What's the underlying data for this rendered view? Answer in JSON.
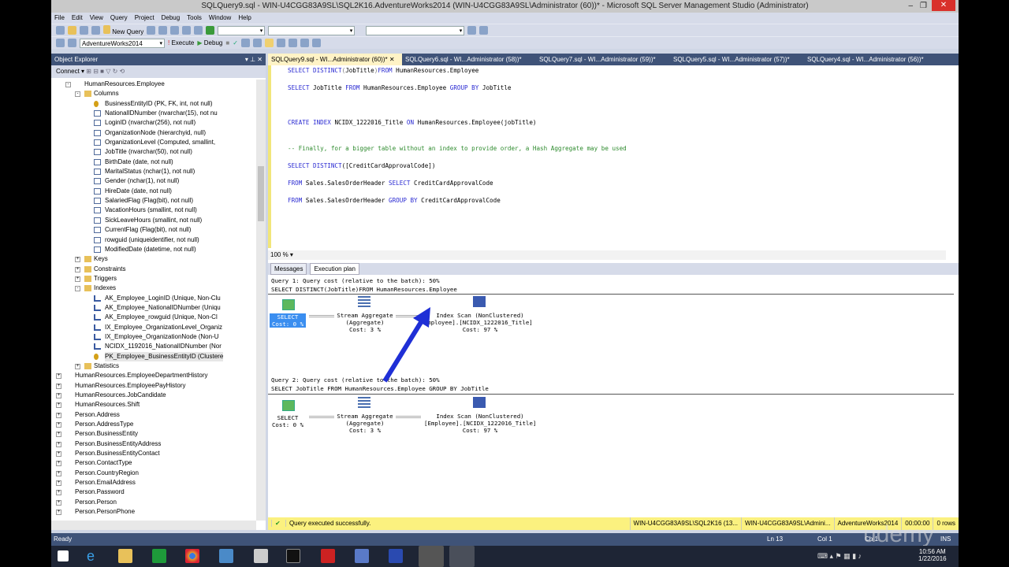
{
  "window": {
    "title": "SQLQuery9.sql - WIN-U4CGG83A9SL\\SQL2K16.AdventureWorks2014 (WIN-U4CGG83A9SL\\Administrator (60))* - Microsoft SQL Server Management Studio (Administrator)"
  },
  "menu": [
    "File",
    "Edit",
    "View",
    "Query",
    "Project",
    "Debug",
    "Tools",
    "Window",
    "Help"
  ],
  "toolbar": {
    "new_query": "New Query",
    "database": "AdventureWorks2014",
    "execute": "Execute",
    "debug": "Debug"
  },
  "object_explorer": {
    "title": "Object Explorer",
    "connect": "Connect ▾",
    "items": [
      {
        "label": "HumanResources.Employee",
        "level": 1,
        "type": "table",
        "exp": "-"
      },
      {
        "label": "Columns",
        "level": 2,
        "type": "folder",
        "exp": "-"
      },
      {
        "label": "BusinessEntityID (PK, FK, int, not null)",
        "level": 3,
        "type": "key"
      },
      {
        "label": "NationalIDNumber (nvarchar(15), not nu",
        "level": 3,
        "type": "col"
      },
      {
        "label": "LoginID (nvarchar(256), not null)",
        "level": 3,
        "type": "col"
      },
      {
        "label": "OrganizationNode (hierarchyid, null)",
        "level": 3,
        "type": "col"
      },
      {
        "label": "OrganizationLevel (Computed, smallint,",
        "level": 3,
        "type": "col"
      },
      {
        "label": "JobTitle (nvarchar(50), not null)",
        "level": 3,
        "type": "col"
      },
      {
        "label": "BirthDate (date, not null)",
        "level": 3,
        "type": "col"
      },
      {
        "label": "MaritalStatus (nchar(1), not null)",
        "level": 3,
        "type": "col"
      },
      {
        "label": "Gender (nchar(1), not null)",
        "level": 3,
        "type": "col"
      },
      {
        "label": "HireDate (date, not null)",
        "level": 3,
        "type": "col"
      },
      {
        "label": "SalariedFlag (Flag(bit), not null)",
        "level": 3,
        "type": "col"
      },
      {
        "label": "VacationHours (smallint, not null)",
        "level": 3,
        "type": "col"
      },
      {
        "label": "SickLeaveHours (smallint, not null)",
        "level": 3,
        "type": "col"
      },
      {
        "label": "CurrentFlag (Flag(bit), not null)",
        "level": 3,
        "type": "col"
      },
      {
        "label": "rowguid (uniqueidentifier, not null)",
        "level": 3,
        "type": "col"
      },
      {
        "label": "ModifiedDate (datetime, not null)",
        "level": 3,
        "type": "col"
      },
      {
        "label": "Keys",
        "level": 2,
        "type": "folder",
        "exp": "+"
      },
      {
        "label": "Constraints",
        "level": 2,
        "type": "folder",
        "exp": "+"
      },
      {
        "label": "Triggers",
        "level": 2,
        "type": "folder",
        "exp": "+"
      },
      {
        "label": "Indexes",
        "level": 2,
        "type": "folder",
        "exp": "-"
      },
      {
        "label": "AK_Employee_LoginID (Unique, Non-Clu",
        "level": 3,
        "type": "idx"
      },
      {
        "label": "AK_Employee_NationalIDNumber (Uniqu",
        "level": 3,
        "type": "idx"
      },
      {
        "label": "AK_Employee_rowguid (Unique, Non-Cl",
        "level": 3,
        "type": "idx"
      },
      {
        "label": "IX_Employee_OrganizationLevel_Organiz",
        "level": 3,
        "type": "idx"
      },
      {
        "label": "IX_Employee_OrganizationNode (Non-U",
        "level": 3,
        "type": "idx"
      },
      {
        "label": "NCIDX_1192016_NationalIDNumber (Nor",
        "level": 3,
        "type": "idx"
      },
      {
        "label": "PK_Employee_BusinessEntityID (Clustere",
        "level": 3,
        "type": "key"
      },
      {
        "label": "Statistics",
        "level": 2,
        "type": "folder",
        "exp": "+"
      },
      {
        "label": "HumanResources.EmployeeDepartmentHistory",
        "level": 0,
        "type": "table",
        "exp": "+"
      },
      {
        "label": "HumanResources.EmployeePayHistory",
        "level": 0,
        "type": "table",
        "exp": "+"
      },
      {
        "label": "HumanResources.JobCandidate",
        "level": 0,
        "type": "table",
        "exp": "+"
      },
      {
        "label": "HumanResources.Shift",
        "level": 0,
        "type": "table",
        "exp": "+"
      },
      {
        "label": "Person.Address",
        "level": 0,
        "type": "table",
        "exp": "+"
      },
      {
        "label": "Person.AddressType",
        "level": 0,
        "type": "table",
        "exp": "+"
      },
      {
        "label": "Person.BusinessEntity",
        "level": 0,
        "type": "table",
        "exp": "+"
      },
      {
        "label": "Person.BusinessEntityAddress",
        "level": 0,
        "type": "table",
        "exp": "+"
      },
      {
        "label": "Person.BusinessEntityContact",
        "level": 0,
        "type": "table",
        "exp": "+"
      },
      {
        "label": "Person.ContactType",
        "level": 0,
        "type": "table",
        "exp": "+"
      },
      {
        "label": "Person.CountryRegion",
        "level": 0,
        "type": "table",
        "exp": "+"
      },
      {
        "label": "Person.EmailAddress",
        "level": 0,
        "type": "table",
        "exp": "+"
      },
      {
        "label": "Person.Password",
        "level": 0,
        "type": "table",
        "exp": "+"
      },
      {
        "label": "Person.Person",
        "level": 0,
        "type": "table",
        "exp": "+"
      },
      {
        "label": "Person.PersonPhone",
        "level": 0,
        "type": "table",
        "exp": "+"
      }
    ]
  },
  "tabs": [
    "SQLQuery9.sql - WI...Administrator (60))*",
    "SQLQuery6.sql - WI...Administrator (58))*",
    "SQLQuery7.sql - WI...Administrator (59))*",
    "SQLQuery5.sql - WI...Administrator (57))*",
    "SQLQuery4.sql - WI...Administrator (56))*"
  ],
  "code": {
    "l1": [
      "SELECT DISTINCT",
      "(",
      "JobTitle",
      ")",
      "FROM",
      " HumanResources.Employee"
    ],
    "l2": [
      "SELECT",
      " JobTitle ",
      "FROM",
      " HumanResources.Employee ",
      "GROUP BY",
      " JobTitle"
    ],
    "l3": [
      "CREATE INDEX",
      " NCIDX_1222016_Title ",
      "ON",
      " HumanResources.Employee(jobTitle)"
    ],
    "l4": "-- Finally, for a bigger table without an index to provide order, a Hash Aggregate may be used",
    "l5": [
      "SELECT DISTINCT",
      "([CreditCardApprovalCode])"
    ],
    "l6": [
      "FROM",
      " Sales.SalesOrderHeader ",
      "SELECT",
      " CreditCardApprovalCode"
    ],
    "l7": [
      "FROM",
      " Sales.SalesOrderHeader ",
      "GROUP BY",
      " CreditCardApprovalCode"
    ]
  },
  "zoom": "100 %",
  "results": {
    "messages": "Messages",
    "plan": "Execution plan"
  },
  "plan": {
    "q1_header": "Query 1: Query cost (relative to the batch): 50%",
    "q1_sql": "SELECT DISTINCT(JobTitle)FROM HumanResources.Employee",
    "q2_header": "Query 2: Query cost (relative to the batch): 50%",
    "q2_sql": "SELECT JobTitle FROM HumanResources.Employee GROUP BY JobTitle",
    "select": "SELECT\nCost: 0 %",
    "stream": "Stream Aggregate\n(Aggregate)\nCost: 3 %",
    "scan1": "Index Scan (NonClustered)\nmployee].[NCIDX_1222016_Title]\nCost: 97 %",
    "scan2": "Index Scan (NonClustered)\n[Employee].[NCIDX_1222016_Title]\nCost: 97 %",
    "arrow_color": "#1f2fd6"
  },
  "status": {
    "message": "Query executed successfully.",
    "server": "WIN-U4CGG83A9SL\\SQL2K16 (13...",
    "user": "WIN-U4CGG83A9SL\\Admini...",
    "db": "AdventureWorks2014",
    "time": "00:00:00",
    "rows": "0 rows"
  },
  "statusbar": {
    "ready": "Ready",
    "ln": "Ln 13",
    "col": "Col 1",
    "ch": "Ch 1",
    "ins": "INS"
  },
  "watermark": "udemy",
  "clock": {
    "time": "10:56 AM",
    "date": "1/22/2016"
  }
}
